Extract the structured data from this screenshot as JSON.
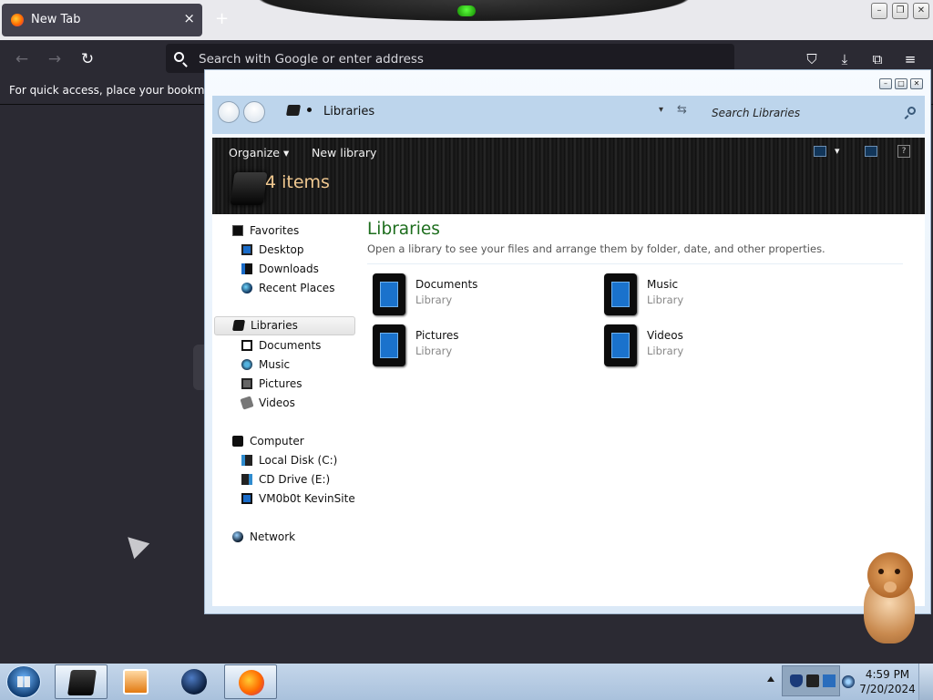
{
  "browser": {
    "tab_title": "New Tab",
    "tab_close": "×",
    "new_tab": "+",
    "back_icon": "←",
    "forward_icon": "→",
    "reload_icon": "↻",
    "address_placeholder": "Search with Google or enter address",
    "pocket_icon": "⛉",
    "download_icon": "⤓",
    "extensions_icon": "⧉",
    "menu_icon": "≡",
    "bookmarks_hint": "For quick access, place your bookmarks h",
    "window_controls": [
      "–",
      "❐",
      "✕"
    ]
  },
  "explorer": {
    "window_controls": [
      "–",
      "□",
      "✕"
    ],
    "address": "Libraries",
    "search_placeholder": "Search Libraries",
    "dropdown_glyph": "▾",
    "refresh_glyph": "⇆",
    "toolbar": {
      "organize": "Organize ▾",
      "new_library": "New library",
      "view_dropdown": "▾",
      "help": "?"
    },
    "item_count": "4 items",
    "nav": {
      "favorites": "Favorites",
      "desktop": "Desktop",
      "downloads": "Downloads",
      "recent_places": "Recent Places",
      "libraries": "Libraries",
      "documents": "Documents",
      "music": "Music",
      "pictures": "Pictures",
      "videos": "Videos",
      "computer": "Computer",
      "local_disk": "Local Disk (C:)",
      "cd_drive": "CD Drive (E:)",
      "network_share": "VM0b0t KevinSite",
      "network": "Network"
    },
    "content": {
      "heading": "Libraries",
      "description": "Open a library to see your files and arrange them by folder, date, and other properties.",
      "items": [
        {
          "name": "Documents",
          "type": "Library"
        },
        {
          "name": "Music",
          "type": "Library"
        },
        {
          "name": "Pictures",
          "type": "Library"
        },
        {
          "name": "Videos",
          "type": "Library"
        }
      ]
    }
  },
  "taskbar": {
    "time": "4:59 PM",
    "date": "7/20/2024",
    "apps": [
      "libraries-icon",
      "media-player-icon",
      "globe-icon",
      "firefox-icon"
    ]
  }
}
